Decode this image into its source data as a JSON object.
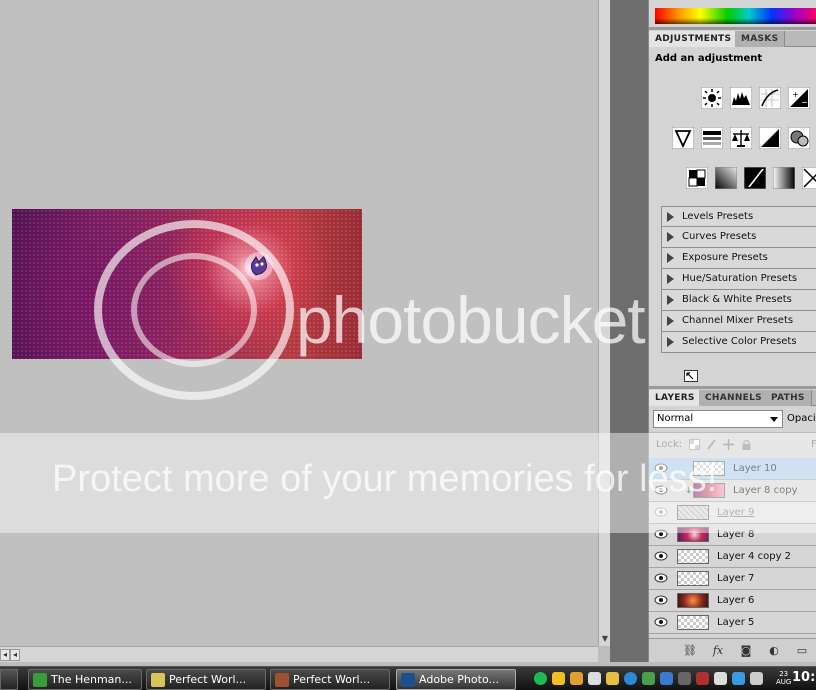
{
  "adjustments_panel": {
    "tabs": [
      "ADJUSTMENTS",
      "MASKS"
    ],
    "title": "Add an adjustment",
    "presets": [
      "Levels Presets",
      "Curves Presets",
      "Exposure Presets",
      "Hue/Saturation Presets",
      "Black & White Presets",
      "Channel Mixer Presets",
      "Selective Color Presets"
    ]
  },
  "layers_panel": {
    "tabs": [
      "LAYERS",
      "CHANNELS",
      "PATHS"
    ],
    "blend_mode": "Normal",
    "opacity_label": "Opaci",
    "lock_label": "Lock:",
    "fill_label": "F",
    "layers": [
      {
        "name": "Layer 10",
        "selected": true
      },
      {
        "name": "Layer 8 copy",
        "selected": false
      },
      {
        "name": "Layer 9",
        "selected": false
      },
      {
        "name": "Layer 8",
        "selected": false
      },
      {
        "name": "Layer 4 copy 2",
        "selected": false
      },
      {
        "name": "Layer 7",
        "selected": false
      },
      {
        "name": "Layer 6",
        "selected": false
      },
      {
        "name": "Layer 5",
        "selected": false
      }
    ]
  },
  "taskbar": {
    "items": [
      {
        "label": "The Henman...",
        "icon": "messenger-icon",
        "color": "#3a9d3a"
      },
      {
        "label": "Perfect Worl...",
        "icon": "notepad-icon",
        "color": "#d8c55a"
      },
      {
        "label": "Perfect Worl...",
        "icon": "game-icon",
        "color": "#a05030"
      },
      {
        "label": "Adobe Photo...",
        "icon": "photoshop-icon",
        "color": "#1f4f8f"
      }
    ],
    "clock": "10:",
    "date_day": "23",
    "date_month": "AUG"
  },
  "watermark": {
    "brand": "photobucket",
    "protect_text": "Protect more of your memories for less!"
  },
  "colors": {
    "selection": "#a9c8ec",
    "panel_bg": "#d4d4d4",
    "workspace_bg": "#c0c0c0"
  }
}
